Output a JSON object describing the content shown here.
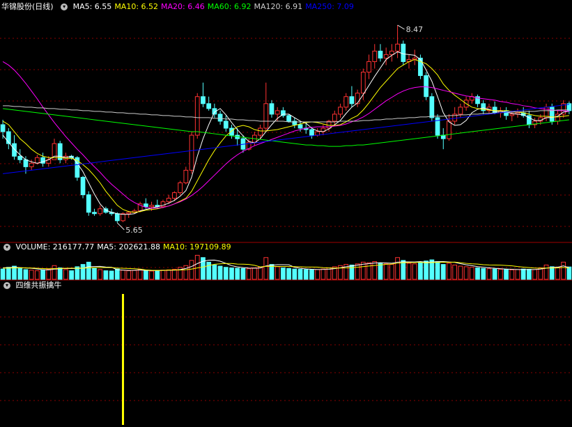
{
  "title": {
    "stock_name": "华锦股份(日线)",
    "ma_items": [
      {
        "label": "MA5: 6.55",
        "color": "#ffffff"
      },
      {
        "label": "MA10: 6.52",
        "color": "#ffff00"
      },
      {
        "label": "MA20: 6.46",
        "color": "#ff00ff"
      },
      {
        "label": "MA60: 6.92",
        "color": "#00ff00"
      },
      {
        "label": "MA120: 6.91",
        "color": "#cccccc"
      },
      {
        "label": "MA250: 7.09",
        "color": "#0000ff"
      }
    ]
  },
  "volume_panel": {
    "items": [
      {
        "label": "VOLUME: 216177.77",
        "color": "#ffffff"
      },
      {
        "label": "MA5: 202621.88",
        "color": "#ffffff"
      },
      {
        "label": "MA10: 197109.89",
        "color": "#ffff00"
      }
    ]
  },
  "indicator_panel": {
    "label": "四维共振擒牛"
  },
  "colors": {
    "up": "#ff3232",
    "down": "#54ffff",
    "grid": "#8b0000",
    "signal": "#ffff00"
  },
  "chart_data": {
    "type": "candlestick",
    "ylim": [
      5.4,
      8.65
    ],
    "annotations": [
      {
        "text": "8.47",
        "index": 69,
        "value": 8.47
      },
      {
        "text": "5.65",
        "index": 20,
        "value": 5.65
      }
    ],
    "ohlc": [
      [
        7.05,
        7.12,
        6.85,
        6.95
      ],
      [
        6.95,
        7.0,
        6.7,
        6.78
      ],
      [
        6.78,
        6.9,
        6.55,
        6.6
      ],
      [
        6.6,
        6.7,
        6.5,
        6.55
      ],
      [
        6.55,
        6.6,
        6.35,
        6.45
      ],
      [
        6.45,
        6.55,
        6.4,
        6.5
      ],
      [
        6.5,
        6.62,
        6.48,
        6.58
      ],
      [
        6.58,
        6.65,
        6.45,
        6.5
      ],
      [
        6.5,
        6.6,
        6.45,
        6.55
      ],
      [
        6.55,
        6.85,
        6.55,
        6.78
      ],
      [
        6.78,
        6.82,
        6.5,
        6.55
      ],
      [
        6.55,
        6.65,
        6.5,
        6.6
      ],
      [
        6.6,
        6.62,
        6.55,
        6.58
      ],
      [
        6.58,
        6.6,
        6.25,
        6.3
      ],
      [
        6.3,
        6.32,
        6.0,
        6.05
      ],
      [
        6.05,
        6.1,
        5.75,
        5.8
      ],
      [
        5.8,
        5.85,
        5.75,
        5.78
      ],
      [
        5.78,
        5.9,
        5.75,
        5.85
      ],
      [
        5.85,
        5.88,
        5.78,
        5.8
      ],
      [
        5.8,
        5.85,
        5.75,
        5.78
      ],
      [
        5.78,
        5.8,
        5.65,
        5.68
      ],
      [
        5.68,
        5.8,
        5.66,
        5.78
      ],
      [
        5.78,
        5.82,
        5.72,
        5.8
      ],
      [
        5.8,
        5.85,
        5.78,
        5.82
      ],
      [
        5.82,
        5.95,
        5.8,
        5.92
      ],
      [
        5.92,
        6.0,
        5.85,
        5.88
      ],
      [
        5.88,
        5.95,
        5.82,
        5.9
      ],
      [
        5.9,
        5.98,
        5.85,
        5.88
      ],
      [
        5.88,
        5.98,
        5.86,
        5.95
      ],
      [
        5.95,
        6.05,
        5.92,
        6.0
      ],
      [
        6.0,
        6.1,
        5.96,
        6.08
      ],
      [
        6.08,
        6.25,
        6.05,
        6.22
      ],
      [
        6.22,
        6.45,
        6.2,
        6.4
      ],
      [
        6.4,
        6.95,
        6.35,
        6.9
      ],
      [
        6.9,
        7.5,
        6.85,
        7.45
      ],
      [
        7.45,
        7.65,
        7.3,
        7.35
      ],
      [
        7.35,
        7.45,
        7.25,
        7.28
      ],
      [
        7.28,
        7.35,
        7.15,
        7.2
      ],
      [
        7.2,
        7.25,
        7.05,
        7.1
      ],
      [
        7.1,
        7.18,
        6.95,
        7.0
      ],
      [
        7.0,
        7.05,
        6.85,
        6.9
      ],
      [
        6.9,
        7.0,
        6.75,
        6.85
      ],
      [
        6.85,
        6.9,
        6.65,
        6.7
      ],
      [
        6.7,
        6.85,
        6.68,
        6.8
      ],
      [
        6.8,
        6.95,
        6.75,
        6.9
      ],
      [
        6.9,
        7.05,
        6.85,
        7.0
      ],
      [
        7.0,
        7.65,
        6.95,
        7.35
      ],
      [
        7.35,
        7.4,
        7.15,
        7.2
      ],
      [
        7.2,
        7.3,
        7.1,
        7.25
      ],
      [
        7.25,
        7.3,
        7.15,
        7.18
      ],
      [
        7.18,
        7.2,
        7.08,
        7.1
      ],
      [
        7.1,
        7.15,
        7.0,
        7.05
      ],
      [
        7.05,
        7.1,
        6.95,
        7.0
      ],
      [
        7.0,
        7.08,
        6.92,
        6.98
      ],
      [
        6.98,
        7.02,
        6.85,
        6.9
      ],
      [
        6.9,
        7.0,
        6.88,
        6.95
      ],
      [
        6.95,
        7.05,
        6.9,
        7.0
      ],
      [
        7.0,
        7.12,
        6.95,
        7.1
      ],
      [
        7.1,
        7.25,
        7.05,
        7.2
      ],
      [
        7.2,
        7.35,
        7.15,
        7.3
      ],
      [
        7.3,
        7.5,
        7.25,
        7.45
      ],
      [
        7.45,
        7.6,
        7.3,
        7.35
      ],
      [
        7.35,
        7.55,
        7.3,
        7.5
      ],
      [
        7.5,
        7.85,
        7.4,
        7.8
      ],
      [
        7.8,
        8.05,
        7.7,
        7.95
      ],
      [
        7.95,
        8.2,
        7.85,
        8.1
      ],
      [
        8.1,
        8.2,
        7.95,
        8.0
      ],
      [
        8.0,
        8.15,
        7.9,
        8.05
      ],
      [
        8.05,
        8.2,
        7.95,
        8.1
      ],
      [
        8.1,
        8.47,
        8.0,
        8.2
      ],
      [
        8.2,
        8.25,
        7.9,
        7.95
      ],
      [
        7.95,
        8.05,
        7.85,
        7.98
      ],
      [
        7.98,
        8.12,
        7.9,
        8.0
      ],
      [
        8.0,
        8.05,
        7.7,
        7.75
      ],
      [
        7.75,
        7.8,
        7.4,
        7.45
      ],
      [
        7.45,
        7.5,
        7.1,
        7.15
      ],
      [
        7.15,
        7.2,
        6.85,
        6.9
      ],
      [
        6.9,
        7.0,
        6.7,
        6.85
      ],
      [
        6.85,
        7.2,
        6.82,
        7.1
      ],
      [
        7.1,
        7.3,
        7.05,
        7.2
      ],
      [
        7.2,
        7.35,
        7.15,
        7.3
      ],
      [
        7.3,
        7.45,
        7.25,
        7.4
      ],
      [
        7.4,
        7.5,
        7.35,
        7.45
      ],
      [
        7.45,
        7.48,
        7.3,
        7.35
      ],
      [
        7.35,
        7.4,
        7.2,
        7.25
      ],
      [
        7.25,
        7.35,
        7.2,
        7.3
      ],
      [
        7.3,
        7.38,
        7.2,
        7.22
      ],
      [
        7.22,
        7.3,
        7.15,
        7.25
      ],
      [
        7.25,
        7.3,
        7.12,
        7.18
      ],
      [
        7.18,
        7.25,
        7.1,
        7.2
      ],
      [
        7.2,
        7.28,
        7.15,
        7.22
      ],
      [
        7.22,
        7.3,
        7.15,
        7.18
      ],
      [
        7.18,
        7.25,
        7.0,
        7.05
      ],
      [
        7.05,
        7.15,
        7.0,
        7.1
      ],
      [
        7.1,
        7.2,
        7.05,
        7.15
      ],
      [
        7.15,
        7.35,
        7.1,
        7.3
      ],
      [
        7.3,
        7.35,
        7.05,
        7.1
      ],
      [
        7.1,
        7.25,
        7.05,
        7.2
      ],
      [
        7.2,
        7.4,
        7.15,
        7.35
      ],
      [
        7.35,
        7.38,
        7.2,
        7.25
      ]
    ],
    "ma5": [
      6.9,
      6.8,
      6.7,
      6.62,
      6.55,
      6.52,
      6.5,
      6.52,
      6.55,
      6.6,
      6.6,
      6.58,
      6.6,
      6.5,
      6.38,
      6.22,
      6.06,
      5.92,
      5.83,
      5.8,
      5.78,
      5.77,
      5.77,
      5.78,
      5.82,
      5.84,
      5.86,
      5.88,
      5.9,
      5.93,
      5.97,
      6.03,
      6.11,
      6.3,
      6.6,
      6.85,
      7.05,
      7.23,
      7.28,
      7.19,
      7.08,
      6.98,
      6.89,
      6.81,
      6.79,
      6.85,
      6.95,
      7.05,
      7.14,
      7.2,
      7.2,
      7.15,
      7.1,
      7.07,
      7.0,
      6.96,
      6.95,
      6.99,
      7.05,
      7.11,
      7.21,
      7.3,
      7.36,
      7.48,
      7.61,
      7.74,
      7.86,
      7.98,
      8.04,
      8.09,
      8.06,
      8.05,
      8.04,
      7.98,
      7.83,
      7.67,
      7.45,
      7.22,
      7.09,
      7.04,
      7.05,
      7.11,
      7.22,
      7.27,
      7.29,
      7.27,
      7.24,
      7.24,
      7.23,
      7.21,
      7.2,
      7.19,
      7.15,
      7.11,
      7.11,
      7.15,
      7.15,
      7.17,
      7.23,
      7.24
    ],
    "ma10": [
      7.1,
      7.05,
      6.95,
      6.85,
      6.78,
      6.7,
      6.64,
      6.6,
      6.58,
      6.58,
      6.58,
      6.57,
      6.57,
      6.54,
      6.48,
      6.41,
      6.32,
      6.22,
      6.1,
      6.0,
      5.9,
      5.84,
      5.81,
      5.8,
      5.81,
      5.83,
      5.84,
      5.85,
      5.87,
      5.89,
      5.92,
      5.96,
      6.0,
      6.1,
      6.25,
      6.4,
      6.55,
      6.68,
      6.79,
      6.89,
      6.96,
      7.02,
      7.04,
      7.02,
      6.98,
      6.96,
      6.96,
      6.97,
      6.98,
      7.0,
      7.02,
      7.04,
      7.06,
      7.08,
      7.09,
      7.08,
      7.06,
      7.04,
      7.04,
      7.05,
      7.09,
      7.14,
      7.18,
      7.26,
      7.36,
      7.47,
      7.58,
      7.67,
      7.76,
      7.85,
      7.9,
      7.95,
      7.98,
      7.95,
      7.92,
      7.85,
      7.76,
      7.63,
      7.54,
      7.47,
      7.41,
      7.35,
      7.3,
      7.28,
      7.27,
      7.26,
      7.25,
      7.25,
      7.25,
      7.24,
      7.23,
      7.22,
      7.2,
      7.18,
      7.17,
      7.17,
      7.16,
      7.16,
      7.17,
      7.18
    ],
    "ma20": [
      7.95,
      7.9,
      7.83,
      7.74,
      7.64,
      7.53,
      7.42,
      7.3,
      7.19,
      7.08,
      6.98,
      6.88,
      6.79,
      6.7,
      6.62,
      6.53,
      6.45,
      6.37,
      6.28,
      6.2,
      6.13,
      6.06,
      5.99,
      5.94,
      5.9,
      5.87,
      5.86,
      5.86,
      5.87,
      5.89,
      5.92,
      5.95,
      5.99,
      6.04,
      6.1,
      6.17,
      6.25,
      6.33,
      6.41,
      6.49,
      6.56,
      6.62,
      6.67,
      6.71,
      6.75,
      6.78,
      6.81,
      6.84,
      6.87,
      6.9,
      6.93,
      6.96,
      6.98,
      7.0,
      7.01,
      7.02,
      7.02,
      7.02,
      7.03,
      7.04,
      7.06,
      7.09,
      7.12,
      7.16,
      7.21,
      7.27,
      7.33,
      7.39,
      7.44,
      7.49,
      7.53,
      7.56,
      7.58,
      7.59,
      7.59,
      7.58,
      7.56,
      7.54,
      7.52,
      7.5,
      7.48,
      7.46,
      7.45,
      7.43,
      7.42,
      7.41,
      7.4,
      7.38,
      7.37,
      7.35,
      7.34,
      7.32,
      7.31,
      7.29,
      7.28,
      7.27,
      7.26,
      7.25,
      7.25,
      7.24
    ],
    "ma60": [
      7.28,
      7.27,
      7.26,
      7.25,
      7.24,
      7.23,
      7.22,
      7.21,
      7.2,
      7.19,
      7.18,
      7.17,
      7.16,
      7.15,
      7.14,
      7.13,
      7.12,
      7.11,
      7.1,
      7.09,
      7.08,
      7.07,
      7.06,
      7.05,
      7.04,
      7.03,
      7.02,
      7.01,
      7.0,
      6.99,
      6.98,
      6.97,
      6.96,
      6.95,
      6.95,
      6.94,
      6.93,
      6.92,
      6.91,
      6.9,
      6.89,
      6.88,
      6.87,
      6.86,
      6.85,
      6.84,
      6.83,
      6.82,
      6.81,
      6.8,
      6.79,
      6.78,
      6.77,
      6.76,
      6.76,
      6.75,
      6.75,
      6.74,
      6.74,
      6.74,
      6.75,
      6.75,
      6.76,
      6.76,
      6.77,
      6.78,
      6.79,
      6.8,
      6.81,
      6.82,
      6.83,
      6.84,
      6.85,
      6.86,
      6.87,
      6.88,
      6.89,
      6.9,
      6.91,
      6.92,
      6.93,
      6.94,
      6.95,
      6.96,
      6.97,
      6.98,
      6.99,
      7.0,
      7.01,
      7.02,
      7.03,
      7.04,
      7.05,
      7.06,
      7.07,
      7.08,
      7.09,
      7.1,
      7.11,
      7.12
    ],
    "ma120": [
      7.32,
      7.32,
      7.31,
      7.31,
      7.3,
      7.3,
      7.29,
      7.29,
      7.28,
      7.28,
      7.27,
      7.27,
      7.26,
      7.26,
      7.25,
      7.25,
      7.24,
      7.24,
      7.23,
      7.23,
      7.22,
      7.22,
      7.21,
      7.21,
      7.2,
      7.2,
      7.19,
      7.19,
      7.18,
      7.18,
      7.17,
      7.17,
      7.16,
      7.16,
      7.15,
      7.15,
      7.15,
      7.14,
      7.14,
      7.13,
      7.13,
      7.12,
      7.12,
      7.11,
      7.11,
      7.1,
      7.1,
      7.1,
      7.1,
      7.1,
      7.09,
      7.09,
      7.09,
      7.09,
      7.09,
      7.09,
      7.09,
      7.09,
      7.09,
      7.1,
      7.1,
      7.1,
      7.1,
      7.11,
      7.11,
      7.12,
      7.12,
      7.13,
      7.13,
      7.14,
      7.14,
      7.15,
      7.15,
      7.16,
      7.16,
      7.17,
      7.17,
      7.17,
      7.18,
      7.18,
      7.19,
      7.19,
      7.2,
      7.2,
      7.21,
      7.21,
      7.22,
      7.22,
      7.23,
      7.23,
      7.23,
      7.24,
      7.24,
      7.24,
      7.25,
      7.25,
      7.25,
      7.26,
      7.26,
      7.26
    ],
    "ma250": [
      6.35,
      6.36,
      6.37,
      6.38,
      6.39,
      6.4,
      6.41,
      6.42,
      6.43,
      6.44,
      6.45,
      6.46,
      6.47,
      6.48,
      6.49,
      6.5,
      6.51,
      6.52,
      6.53,
      6.54,
      6.55,
      6.56,
      6.57,
      6.58,
      6.59,
      6.6,
      6.61,
      6.62,
      6.63,
      6.64,
      6.65,
      6.66,
      6.67,
      6.68,
      6.69,
      6.7,
      6.71,
      6.72,
      6.73,
      6.74,
      6.75,
      6.76,
      6.77,
      6.78,
      6.79,
      6.8,
      6.81,
      6.82,
      6.83,
      6.84,
      6.85,
      6.86,
      6.87,
      6.88,
      6.89,
      6.9,
      6.91,
      6.92,
      6.93,
      6.94,
      6.95,
      6.96,
      6.97,
      6.98,
      6.99,
      7.0,
      7.01,
      7.02,
      7.03,
      7.04,
      7.05,
      7.06,
      7.07,
      7.08,
      7.09,
      7.1,
      7.11,
      7.12,
      7.13,
      7.14,
      7.15,
      7.16,
      7.17,
      7.18,
      7.19,
      7.2,
      7.21,
      7.22,
      7.23,
      7.24,
      7.25,
      7.26,
      7.27,
      7.28,
      7.29,
      7.3,
      7.31,
      7.32,
      7.33,
      7.34
    ],
    "volume_ylim": [
      0,
      450000
    ],
    "volume": [
      180000,
      210000,
      230000,
      195000,
      170000,
      160000,
      150000,
      165000,
      175000,
      240000,
      200000,
      170000,
      150000,
      220000,
      260000,
      300000,
      190000,
      170000,
      150000,
      145000,
      180000,
      160000,
      150000,
      155000,
      170000,
      150000,
      145000,
      150000,
      160000,
      165000,
      175000,
      210000,
      240000,
      330000,
      420000,
      380000,
      300000,
      250000,
      230000,
      210000,
      200000,
      195000,
      190000,
      185000,
      200000,
      215000,
      380000,
      260000,
      220000,
      200000,
      190000,
      180000,
      175000,
      170000,
      165000,
      170000,
      180000,
      200000,
      220000,
      240000,
      260000,
      250000,
      270000,
      300000,
      290000,
      310000,
      280000,
      270000,
      260000,
      380000,
      330000,
      280000,
      270000,
      300000,
      320000,
      340000,
      310000,
      260000,
      280000,
      250000,
      230000,
      220000,
      210000,
      200000,
      190000,
      185000,
      180000,
      175000,
      170000,
      165000,
      170000,
      180000,
      175000,
      170000,
      200000,
      250000,
      220000,
      215000,
      300000,
      216177
    ],
    "vol_ma5": [
      200000,
      205000,
      210000,
      205000,
      197000,
      193000,
      181000,
      168000,
      164000,
      178000,
      186000,
      190000,
      189000,
      191000,
      192000,
      222000,
      224000,
      226000,
      214000,
      211000,
      167000,
      161000,
      157000,
      158000,
      163000,
      157000,
      154000,
      154000,
      155000,
      158000,
      159000,
      170000,
      190000,
      224000,
      275000,
      316000,
      334000,
      336000,
      316000,
      278000,
      238000,
      217000,
      205000,
      196000,
      194000,
      197000,
      235000,
      246000,
      255000,
      255000,
      254000,
      210000,
      193000,
      183000,
      176000,
      172000,
      173000,
      177000,
      187000,
      202000,
      220000,
      234000,
      248000,
      264000,
      274000,
      284000,
      290000,
      286000,
      282000,
      300000,
      306000,
      304000,
      302000,
      310000,
      300000,
      302000,
      308000,
      310000,
      302000,
      296000,
      274000,
      254000,
      238000,
      222000,
      211000,
      201000,
      193000,
      186000,
      180000,
      175000,
      172000,
      172000,
      172000,
      172000,
      179000,
      195000,
      207000,
      212000,
      236000,
      202621
    ],
    "vol_ma10": [
      195000,
      197000,
      199000,
      200000,
      199000,
      197000,
      193000,
      189000,
      186000,
      187000,
      190000,
      193000,
      194000,
      195000,
      195000,
      201000,
      204000,
      206000,
      205000,
      205000,
      196000,
      193000,
      190000,
      185000,
      179000,
      164000,
      158000,
      156000,
      157000,
      161000,
      163000,
      163000,
      167000,
      180000,
      199000,
      215000,
      241000,
      263000,
      270000,
      277000,
      277000,
      266000,
      264000,
      260000,
      245000,
      217000,
      226000,
      226000,
      225000,
      225000,
      224000,
      222000,
      219000,
      215000,
      215000,
      213000,
      204000,
      199000,
      196000,
      197000,
      199000,
      204000,
      211000,
      222000,
      232000,
      241000,
      251000,
      262000,
      268000,
      282000,
      290000,
      294000,
      294000,
      298000,
      288000,
      293000,
      297000,
      299000,
      296000,
      301000,
      290000,
      279000,
      270000,
      266000,
      255000,
      251000,
      250000,
      248000,
      242000,
      236000,
      223000,
      213000,
      205000,
      197000,
      195000,
      198000,
      199000,
      199000,
      208000,
      197109
    ],
    "signal_index": 21
  }
}
